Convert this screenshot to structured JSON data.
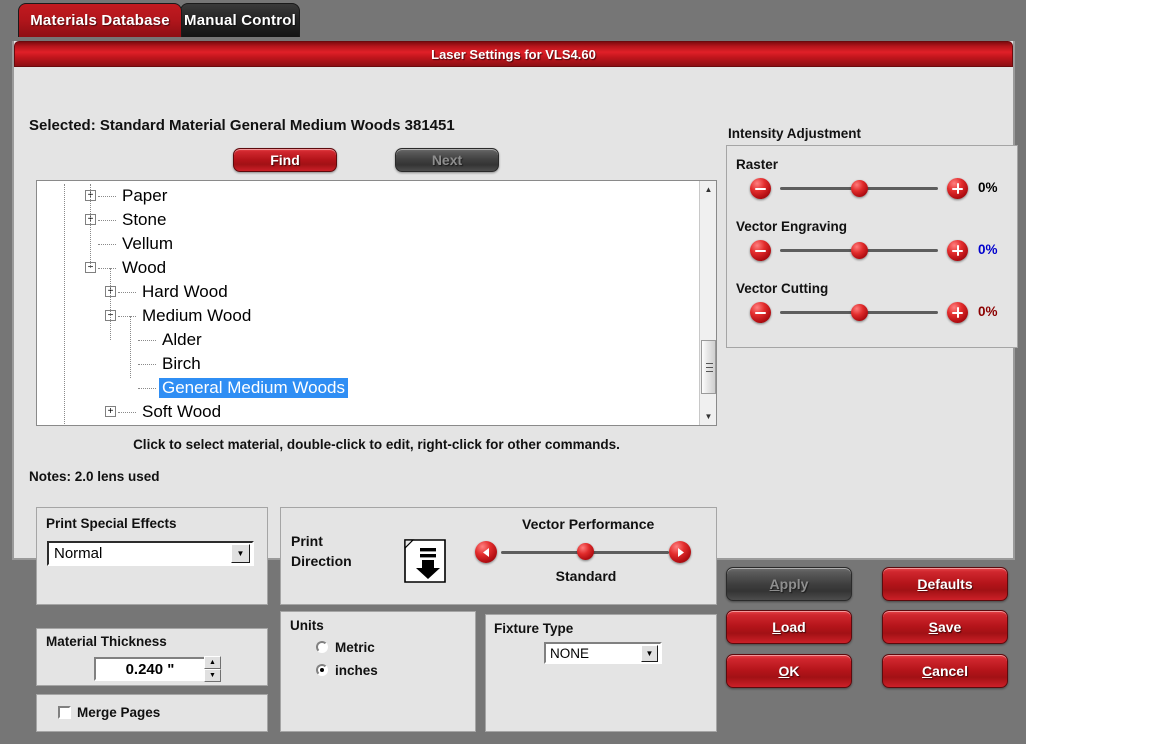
{
  "tabs": [
    {
      "label": "Materials Database",
      "active": true
    },
    {
      "label": "Manual Control",
      "active": false
    }
  ],
  "dialog": {
    "title": "Laser Settings for VLS4.60",
    "selected_label": "Selected: Standard Material General Medium Woods 381451",
    "find_button": "Find",
    "next_button": "Next",
    "hint": "Click to select material, double-click to edit, right-click for other commands.",
    "notes": "Notes: 2.0 lens used"
  },
  "tree": {
    "items": [
      {
        "label": "Paper",
        "depth": 0,
        "toggle": "+",
        "selected": false
      },
      {
        "label": "Stone",
        "depth": 0,
        "toggle": "+",
        "selected": false
      },
      {
        "label": "Vellum",
        "depth": 0,
        "toggle": "",
        "selected": false
      },
      {
        "label": "Wood",
        "depth": 0,
        "toggle": "−",
        "selected": false
      },
      {
        "label": "Hard Wood",
        "depth": 1,
        "toggle": "+",
        "selected": false
      },
      {
        "label": "Medium Wood",
        "depth": 1,
        "toggle": "−",
        "selected": false
      },
      {
        "label": "Alder",
        "depth": 2,
        "toggle": "",
        "selected": false
      },
      {
        "label": "Birch",
        "depth": 2,
        "toggle": "",
        "selected": false
      },
      {
        "label": "General Medium Woods",
        "depth": 2,
        "toggle": "",
        "selected": true
      },
      {
        "label": "Soft Wood",
        "depth": 1,
        "toggle": "+",
        "selected": false
      }
    ],
    "selection_color": "#2f8ef4",
    "scrollbar": {
      "up": "▲",
      "down": "▼"
    }
  },
  "intensity": {
    "title": "Intensity Adjustment",
    "sliders": [
      {
        "label": "Raster",
        "value": "0%",
        "color": "#000000",
        "knob_pct": 50
      },
      {
        "label": "Vector Engraving",
        "value": "0%",
        "color": "#0000cd",
        "knob_pct": 50
      },
      {
        "label": "Vector Cutting",
        "value": "0%",
        "color": "#8b0000",
        "knob_pct": 50
      }
    ],
    "minus_icon": "minus-icon",
    "plus_icon": "plus-icon"
  },
  "print_special_effects": {
    "title": "Print Special Effects",
    "value": "Normal",
    "arrow": "▼"
  },
  "material_thickness": {
    "title": "Material Thickness",
    "value": "0.240 \"",
    "up": "▲",
    "down": "▼"
  },
  "merge_pages": {
    "label": "Merge Pages",
    "checked": false
  },
  "print_direction": {
    "label_line1": "Print",
    "label_line2": "Direction",
    "icon": "page-down-arrow-icon"
  },
  "vector_performance": {
    "title": "Vector Performance",
    "value_label": "Standard",
    "left_arrow": "◀",
    "right_arrow": "▶",
    "knob_pct": 50
  },
  "units": {
    "title": "Units",
    "options": [
      {
        "label": "Metric",
        "selected": false
      },
      {
        "label": "inches",
        "selected": true
      }
    ]
  },
  "fixture_type": {
    "title": "Fixture Type",
    "value": "NONE",
    "arrow": "▼"
  },
  "actions": [
    {
      "id": "apply",
      "mnemonic": "A",
      "rest": "pply",
      "disabled": true
    },
    {
      "id": "defaults",
      "mnemonic": "D",
      "rest": "efaults",
      "disabled": false
    },
    {
      "id": "load",
      "mnemonic": "L",
      "rest": "oad",
      "disabled": false
    },
    {
      "id": "save",
      "mnemonic": "S",
      "rest": "ave",
      "disabled": false
    },
    {
      "id": "ok",
      "mnemonic": "O",
      "rest": "K",
      "disabled": false
    },
    {
      "id": "cancel",
      "mnemonic": "C",
      "rest": "ancel",
      "disabled": false
    }
  ],
  "colors": {
    "accent_red": "#b4141a",
    "window_gray": "#767676",
    "panel_gray": "#e4e4e4"
  }
}
